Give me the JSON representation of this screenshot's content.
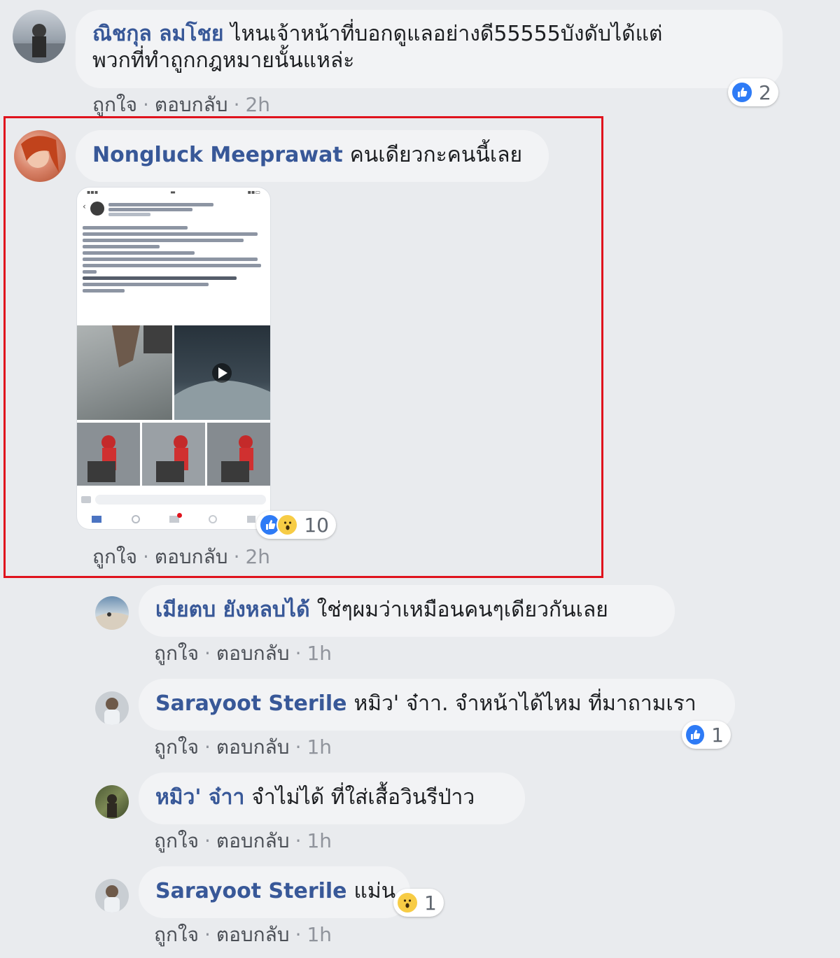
{
  "actions": {
    "like": "ถูกใจ",
    "reply": "ตอบกลับ",
    "separator": "·"
  },
  "comments": [
    {
      "author": "ณิชกุล ลมโชย",
      "text_line1": "ไหนเจ้าหน้าที่บอกดูแลอย่างดี55555บังดับได้แต่",
      "text_line2": "พวกที่ทำถูกกฎหมายนั้นแหล่ะ",
      "time": "2h",
      "reactions": {
        "count": "2"
      }
    },
    {
      "author": "Nongluck Meeprawat",
      "text": "คนเดียวกะคนนี้เลย",
      "time": "2h",
      "reactions": {
        "count": "10"
      }
    }
  ],
  "replies": [
    {
      "author": "เมียตบ ยังหลบได้",
      "text": "ใช่ๆผมว่าเหมือนคนๆเดียวกันเลย",
      "time": "1h"
    },
    {
      "author": "Sarayoot Sterile",
      "text": "หมิว' จ๋าา. จำหน้าได้ไหม ที่มาถามเรา",
      "time": "1h",
      "reactions": {
        "count": "1"
      }
    },
    {
      "author": "หมิว' จ๋าา",
      "text": "จำไม่ได้ ที่ใส่เสื้อวินรีป่าว",
      "time": "1h"
    },
    {
      "author": "Sarayoot Sterile",
      "text": "แม่น",
      "time": "1h",
      "reactions": {
        "count": "1"
      }
    }
  ],
  "colors": {
    "author": "#385898",
    "bubble": "#f2f3f5",
    "highlight": "#e0131d",
    "like": "#2e7bf6",
    "wow": "#f7cc45"
  }
}
